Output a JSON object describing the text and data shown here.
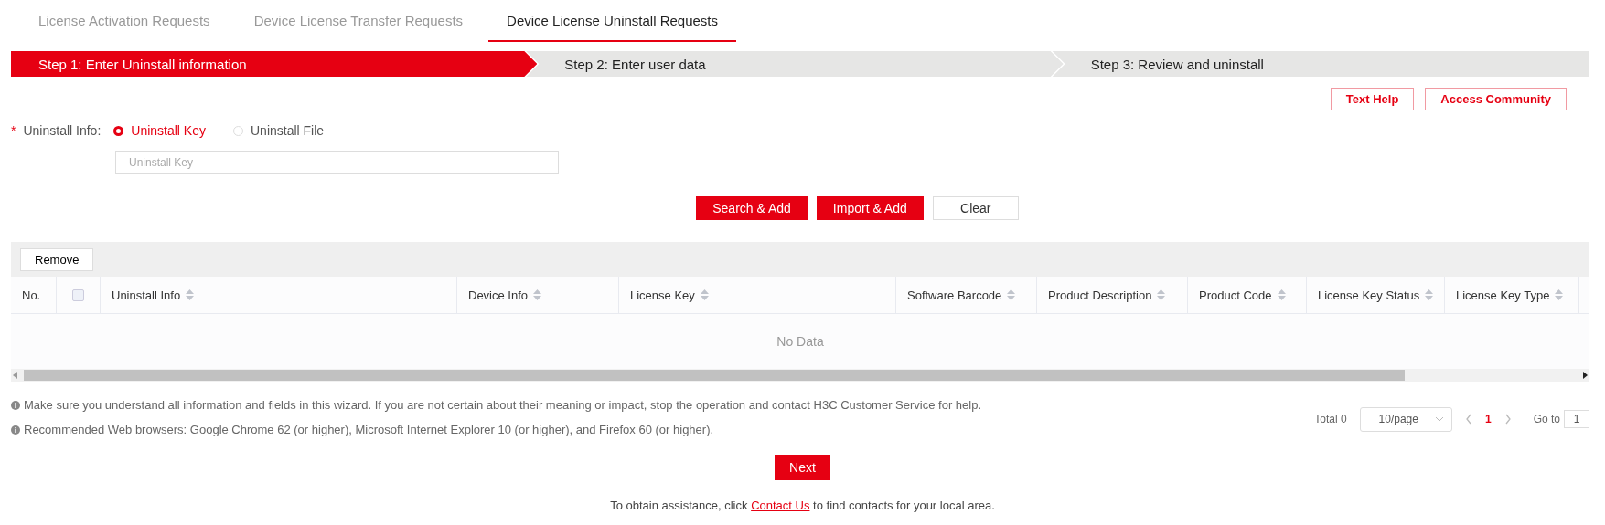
{
  "tabs": [
    {
      "label": "License Activation Requests",
      "selected": false
    },
    {
      "label": "Device License Transfer Requests",
      "selected": false
    },
    {
      "label": "Device License Uninstall Requests",
      "selected": true
    }
  ],
  "steps": [
    {
      "label": "Step 1: Enter Uninstall information",
      "selected": true
    },
    {
      "label": "Step 2: Enter user data",
      "selected": false
    },
    {
      "label": "Step 3: Review and uninstall",
      "selected": false
    }
  ],
  "help_links": [
    "Text Help",
    "Access Community"
  ],
  "uninstall_info": {
    "required_mark": "*",
    "label": "Uninstall Info:",
    "options": [
      {
        "label": "Uninstall Key",
        "selected": true
      },
      {
        "label": "Uninstall File",
        "selected": false
      }
    ],
    "placeholder": "Uninstall Key"
  },
  "actions": [
    {
      "label": "Search & Add",
      "kind": "primary"
    },
    {
      "label": "Import & Add",
      "kind": "primary"
    },
    {
      "label": "Clear",
      "kind": "plain"
    }
  ],
  "table": {
    "toolbar_button": "Remove",
    "columns": [
      {
        "label": "No.",
        "kind": "text"
      },
      {
        "kind": "checkbox"
      },
      {
        "label": "Uninstall Info",
        "kind": "sortable"
      },
      {
        "label": "Device Info",
        "kind": "sortable"
      },
      {
        "label": "License Key",
        "kind": "sortable"
      },
      {
        "label": "Software Barcode",
        "kind": "sortable"
      },
      {
        "label": "Product Description",
        "kind": "sortable"
      },
      {
        "label": "Product Code",
        "kind": "sortable"
      },
      {
        "label": "License Key Status",
        "kind": "sortable"
      },
      {
        "label": "License Key Type",
        "kind": "sortable"
      },
      {
        "kind": "cut"
      }
    ],
    "select_all_checked": false,
    "empty_text": "No Data"
  },
  "notes": [
    "Make sure you understand all information and fields in this wizard. If you are not certain about their meaning or impact, stop the operation and contact H3C Customer Service for help.",
    "Recommended Web browsers: Google Chrome 62 (or higher), Microsoft Internet Explorer 10 (or higher), and Firefox 60 (or higher)."
  ],
  "pagination": {
    "total": "Total 0",
    "page_size": "10/page",
    "pages": [
      {
        "label": "1",
        "selected": true
      }
    ],
    "goto_label": "Go to",
    "goto_value": "1"
  },
  "next_button": "Next",
  "assistance": {
    "before": "To obtain assistance, click",
    "link": "Contact Us",
    "after": "to find contacts for your local area."
  }
}
